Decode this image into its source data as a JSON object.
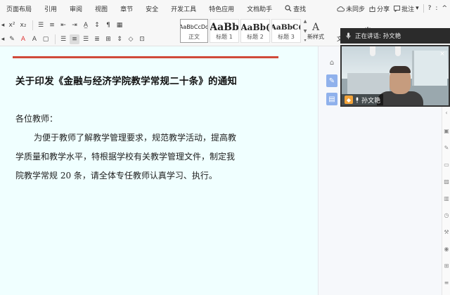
{
  "menubar": {
    "items": [
      "页面布局",
      "引用",
      "审阅",
      "视图",
      "章节",
      "安全",
      "开发工具",
      "特色应用",
      "文档助手"
    ],
    "search_label": "查找",
    "sync_label": "未同步",
    "share_label": "分享",
    "annotate_label": "批注",
    "help_glyph": "?",
    "more_glyph": ":",
    "collapse_glyph": "^"
  },
  "toolbar": {
    "styles": [
      {
        "sample": "AaBbCcDd",
        "label": "正文"
      },
      {
        "sample": "AaBb",
        "label": "标题 1"
      },
      {
        "sample": "AaBb(",
        "label": "标题 2"
      },
      {
        "sample": "AaBbC(",
        "label": "标题 3"
      }
    ],
    "new_style_label": "新样式",
    "wen_label": "文"
  },
  "call": {
    "speaking_label": "正在讲话: 孙文艳",
    "participant_name": "孙文艳"
  },
  "document": {
    "title": "关于印发《金融与经济学院教学常规二十条》的通知",
    "greeting": "各位教师：",
    "lines": [
      "为便于教师了解教学管理要求，规范教学活动，提高教",
      "学质量和教学水平，特根据学校有关教学管理文件，制定我",
      "院教学常规 20 条，请全体专任教师认真学习、执行。"
    ]
  },
  "colors": {
    "ruler": "#d04a3a",
    "doc_background": "#f0ffff"
  }
}
